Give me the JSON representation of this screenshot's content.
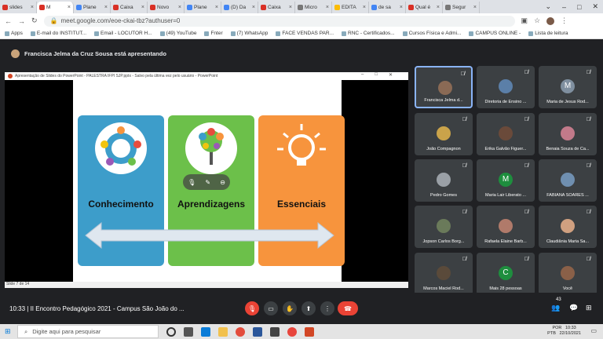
{
  "tabs": [
    {
      "label": "slides",
      "color": "#d93025"
    },
    {
      "label": "M",
      "color": "#d93025",
      "active": true
    },
    {
      "label": "Plane",
      "color": "#4285f4"
    },
    {
      "label": "Caixa",
      "color": "#d93025"
    },
    {
      "label": "Novo",
      "color": "#d93025"
    },
    {
      "label": "Plane",
      "color": "#4285f4"
    },
    {
      "label": "(D) Da",
      "color": "#4285f4"
    },
    {
      "label": "Caixa",
      "color": "#d93025"
    },
    {
      "label": "Micro",
      "color": "#777777"
    },
    {
      "label": "EDITA",
      "color": "#fbbc04"
    },
    {
      "label": "de sa",
      "color": "#4285f4"
    },
    {
      "label": "Qual é",
      "color": "#d93025"
    },
    {
      "label": "Segur",
      "color": "#777777"
    }
  ],
  "url": "meet.google.com/eoe-ckai-tbz?authuser=0",
  "bookmarks": [
    "Apps",
    "E-mail do INSTITUT...",
    "Email - LOCUTOR H...",
    "(49) YouTube",
    "Fnter",
    "(7) WhatsApp",
    "FACE VENDAS PAR...",
    "RNC - Certificados...",
    "Cursos Física e Admi...",
    "CAMPUS ONLINE -",
    "Lista de leitura"
  ],
  "presenter": "Francisca Jelma da Cruz Sousa está apresentando",
  "ppt": {
    "window_title": "Apresentação de Slides do PowerPoint - PALESTRA IFPI SJP.pptx - Salvo pela última vez pelo usuário - PowerPoint",
    "status": "Slide 7 de 14"
  },
  "slide": {
    "cards": [
      {
        "title": "Conhecimento",
        "color": "#3d9dca"
      },
      {
        "title": "Aprendizagens",
        "color": "#6cc04a"
      },
      {
        "title": "Essenciais",
        "color": "#f7943d"
      }
    ]
  },
  "participants": [
    {
      "name": "Francisca Jelma d...",
      "face": "#8a6a55",
      "self": true
    },
    {
      "name": "Diretoria de Ensino ...",
      "face": "#5b7fa8"
    },
    {
      "name": "Maria de Jesus Rod...",
      "initial": "M",
      "face": "#7f8f9f"
    },
    {
      "name": "João Compagnon",
      "face": "#caa34a"
    },
    {
      "name": "Erika Galvão Figuer...",
      "face": "#6a4a3a"
    },
    {
      "name": "Benaia Souza de Ca...",
      "face": "#c27a8a"
    },
    {
      "name": "Pedro Gomes",
      "face": "#9aa0a6"
    },
    {
      "name": "Maria Lair Liberato ...",
      "initial": "M",
      "face": "#1e8e3e"
    },
    {
      "name": "FABIANA SOARES ...",
      "face": "#6f8fb0"
    },
    {
      "name": "Jopson Carlos Borg...",
      "face": "#6a7a5a"
    },
    {
      "name": "Rafaela Elaine Barb...",
      "face": "#b07a6a"
    },
    {
      "name": "Claudiânia Maria Sa...",
      "face": "#d0a080"
    },
    {
      "name": "Marcos Maciel Rod...",
      "face": "#5a4a3a"
    },
    {
      "name": "Mais 28 pessoas",
      "initial": "C",
      "face": "#1e8e3e"
    },
    {
      "name": "Você",
      "face": "#8a6048"
    }
  ],
  "meeting": {
    "time": "10:33",
    "title": "II Encontro Pedagógico 2021 - Campus São João do ...",
    "participants_count": "43"
  },
  "taskbar": {
    "search_placeholder": "Digite aqui para pesquisar",
    "time": "10:33",
    "date": "22/10/2021",
    "lang": "POR",
    "lang2": "PTB"
  }
}
